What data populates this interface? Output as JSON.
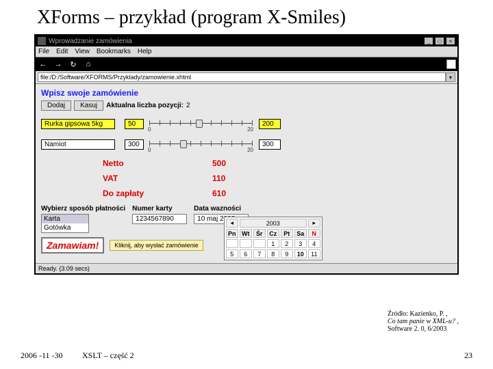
{
  "slide": {
    "title": "XForms – przykład (program X-Smiles)"
  },
  "window": {
    "title": "Wprowadzanie zamówienia"
  },
  "menus": {
    "file": "File",
    "edit": "Edit",
    "view": "View",
    "bookmarks": "Bookmarks",
    "help": "Help"
  },
  "address": "file:/D:/Software/XFORMS/Przyklady/zamowienie.xhtml",
  "form": {
    "heading": "Wpisz swoje zamówienie",
    "add": "Dodaj",
    "del": "Kasuj",
    "countLabel": "Aktualna liczba pozycji:",
    "count": "2",
    "item1": {
      "name": "Rurka gipsowa  5kg",
      "price": "50",
      "slidemin": "0",
      "slidemax": "20",
      "qty": "200"
    },
    "item2": {
      "name": "Namiot",
      "price": "300",
      "slidemin": "0",
      "slidemax": "20",
      "qty": "300"
    },
    "netLabel": "Netto",
    "net": "500",
    "vatLabel": "VAT",
    "vat": "110",
    "totalLabel": "Do zapłaty",
    "total": "610",
    "payHeader": "Wybierz sposób płatności",
    "payOpt1": "Karta",
    "payOpt2": "Gotówka",
    "cardHeader": "Numer karty",
    "cardNo": "1234567890",
    "dateHeader": "Data wazności",
    "dateVal": "10 maj 2003",
    "orderBtn": "Zamawiam!",
    "orderHint": "Kliknij, aby wysłać zamówienie"
  },
  "calendar": {
    "year": "2003",
    "days": [
      "Pn",
      "Wt",
      "Śr",
      "Cz",
      "Pt",
      "Sa",
      "N"
    ],
    "r1": [
      "",
      "",
      "",
      "1",
      "2",
      "3",
      "4"
    ],
    "r2": [
      "5",
      "6",
      "7",
      "8",
      "9",
      "10",
      "11"
    ]
  },
  "status": "Ready. (3.09 secs)",
  "citation": {
    "l1": "Źródło: Kazienko, P. ,",
    "l2": "Co tam panie w XML-u? ,",
    "l3": "Software 2. 0, 6/2003"
  },
  "footer": {
    "date": "2006 -11 -30",
    "mid": "XSLT – część 2",
    "page": "23"
  }
}
